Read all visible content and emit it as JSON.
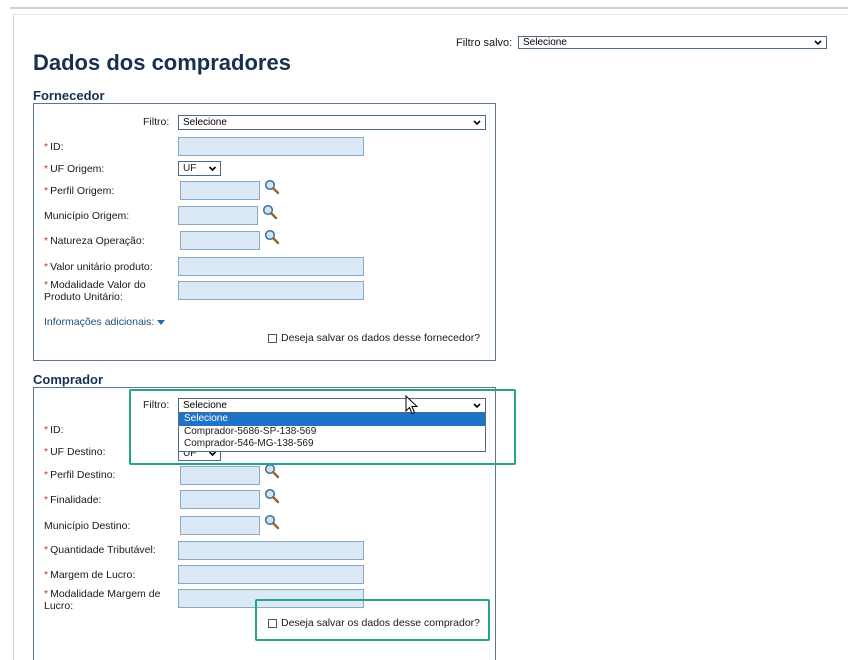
{
  "header": {
    "saved_filter_label": "Filtro salvo:",
    "saved_filter_value": "Selecione",
    "page_title": "Dados dos compradores"
  },
  "fornecedor": {
    "section_title": "Fornecedor",
    "filter_label": "Filtro:",
    "filter_value": "Selecione",
    "fields": {
      "id": "ID:",
      "uf_origem": "UF Origem:",
      "uf_value": "UF",
      "perfil_origem": "Perfil Origem:",
      "municipio_origem": "Município Origem:",
      "natureza_operacao": "Natureza Operação:",
      "valor_unitario": "Valor unitário produto:",
      "modalidade_line1": "Modalidade Valor do",
      "modalidade_line2": "Produto Unitário:"
    },
    "required_mark": "*",
    "more_info_link": "Informações adicionais:",
    "save_checkbox_label": "Deseja salvar os dados desse fornecedor?"
  },
  "comprador": {
    "section_title": "Comprador",
    "filter_label": "Filtro:",
    "filter_value": "Selecione",
    "dropdown_options": [
      "Selecione",
      "Comprador-5686-SP-138-569",
      "Comprador-546-MG-138-569"
    ],
    "fields": {
      "id": "ID:",
      "uf_destino": "UF Destino:",
      "uf_value": "UF",
      "perfil_destino": "Perfil Destino:",
      "finalidade": "Finalidade:",
      "municipio_destino": "Município Destino:",
      "quantidade_tributavel": "Quantidade Tributável:",
      "margem_lucro": "Margem de Lucro:",
      "modalidade_line1": "Modalidade Margem de",
      "modalidade_line2": "Lucro:"
    },
    "required_mark": "*",
    "save_checkbox_label": "Deseja salvar os dados desse comprador?"
  },
  "colors": {
    "heading": "#16304e",
    "field_fill": "#dbe9f6",
    "highlight": "#27a286",
    "selected_option": "#1e73c8",
    "required": "#c0392b"
  }
}
